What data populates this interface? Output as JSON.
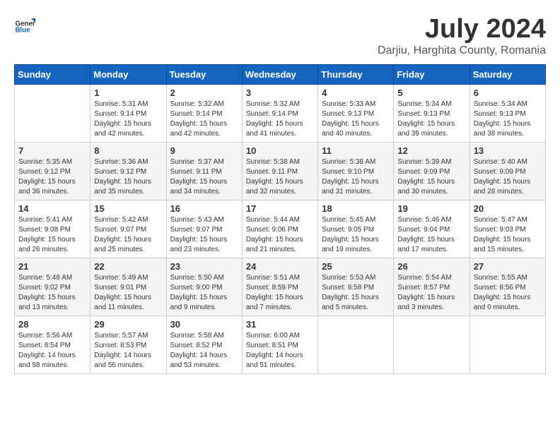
{
  "logo": {
    "general": "General",
    "blue": "Blue"
  },
  "title": "July 2024",
  "subtitle": "Darjiu, Harghita County, Romania",
  "weekdays": [
    "Sunday",
    "Monday",
    "Tuesday",
    "Wednesday",
    "Thursday",
    "Friday",
    "Saturday"
  ],
  "weeks": [
    [
      {
        "day": "",
        "sunrise": "",
        "sunset": "",
        "daylight": ""
      },
      {
        "day": "1",
        "sunrise": "Sunrise: 5:31 AM",
        "sunset": "Sunset: 9:14 PM",
        "daylight": "Daylight: 15 hours and 42 minutes."
      },
      {
        "day": "2",
        "sunrise": "Sunrise: 5:32 AM",
        "sunset": "Sunset: 9:14 PM",
        "daylight": "Daylight: 15 hours and 42 minutes."
      },
      {
        "day": "3",
        "sunrise": "Sunrise: 5:32 AM",
        "sunset": "Sunset: 9:14 PM",
        "daylight": "Daylight: 15 hours and 41 minutes."
      },
      {
        "day": "4",
        "sunrise": "Sunrise: 5:33 AM",
        "sunset": "Sunset: 9:13 PM",
        "daylight": "Daylight: 15 hours and 40 minutes."
      },
      {
        "day": "5",
        "sunrise": "Sunrise: 5:34 AM",
        "sunset": "Sunset: 9:13 PM",
        "daylight": "Daylight: 15 hours and 39 minutes."
      },
      {
        "day": "6",
        "sunrise": "Sunrise: 5:34 AM",
        "sunset": "Sunset: 9:13 PM",
        "daylight": "Daylight: 15 hours and 38 minutes."
      }
    ],
    [
      {
        "day": "7",
        "sunrise": "Sunrise: 5:35 AM",
        "sunset": "Sunset: 9:12 PM",
        "daylight": "Daylight: 15 hours and 36 minutes."
      },
      {
        "day": "8",
        "sunrise": "Sunrise: 5:36 AM",
        "sunset": "Sunset: 9:12 PM",
        "daylight": "Daylight: 15 hours and 35 minutes."
      },
      {
        "day": "9",
        "sunrise": "Sunrise: 5:37 AM",
        "sunset": "Sunset: 9:11 PM",
        "daylight": "Daylight: 15 hours and 34 minutes."
      },
      {
        "day": "10",
        "sunrise": "Sunrise: 5:38 AM",
        "sunset": "Sunset: 9:11 PM",
        "daylight": "Daylight: 15 hours and 32 minutes."
      },
      {
        "day": "11",
        "sunrise": "Sunrise: 5:38 AM",
        "sunset": "Sunset: 9:10 PM",
        "daylight": "Daylight: 15 hours and 31 minutes."
      },
      {
        "day": "12",
        "sunrise": "Sunrise: 5:39 AM",
        "sunset": "Sunset: 9:09 PM",
        "daylight": "Daylight: 15 hours and 30 minutes."
      },
      {
        "day": "13",
        "sunrise": "Sunrise: 5:40 AM",
        "sunset": "Sunset: 9:09 PM",
        "daylight": "Daylight: 15 hours and 28 minutes."
      }
    ],
    [
      {
        "day": "14",
        "sunrise": "Sunrise: 5:41 AM",
        "sunset": "Sunset: 9:08 PM",
        "daylight": "Daylight: 15 hours and 26 minutes."
      },
      {
        "day": "15",
        "sunrise": "Sunrise: 5:42 AM",
        "sunset": "Sunset: 9:07 PM",
        "daylight": "Daylight: 15 hours and 25 minutes."
      },
      {
        "day": "16",
        "sunrise": "Sunrise: 5:43 AM",
        "sunset": "Sunset: 9:07 PM",
        "daylight": "Daylight: 15 hours and 23 minutes."
      },
      {
        "day": "17",
        "sunrise": "Sunrise: 5:44 AM",
        "sunset": "Sunset: 9:06 PM",
        "daylight": "Daylight: 15 hours and 21 minutes."
      },
      {
        "day": "18",
        "sunrise": "Sunrise: 5:45 AM",
        "sunset": "Sunset: 9:05 PM",
        "daylight": "Daylight: 15 hours and 19 minutes."
      },
      {
        "day": "19",
        "sunrise": "Sunrise: 5:46 AM",
        "sunset": "Sunset: 9:04 PM",
        "daylight": "Daylight: 15 hours and 17 minutes."
      },
      {
        "day": "20",
        "sunrise": "Sunrise: 5:47 AM",
        "sunset": "Sunset: 9:03 PM",
        "daylight": "Daylight: 15 hours and 15 minutes."
      }
    ],
    [
      {
        "day": "21",
        "sunrise": "Sunrise: 5:48 AM",
        "sunset": "Sunset: 9:02 PM",
        "daylight": "Daylight: 15 hours and 13 minutes."
      },
      {
        "day": "22",
        "sunrise": "Sunrise: 5:49 AM",
        "sunset": "Sunset: 9:01 PM",
        "daylight": "Daylight: 15 hours and 11 minutes."
      },
      {
        "day": "23",
        "sunrise": "Sunrise: 5:50 AM",
        "sunset": "Sunset: 9:00 PM",
        "daylight": "Daylight: 15 hours and 9 minutes."
      },
      {
        "day": "24",
        "sunrise": "Sunrise: 5:51 AM",
        "sunset": "Sunset: 8:59 PM",
        "daylight": "Daylight: 15 hours and 7 minutes."
      },
      {
        "day": "25",
        "sunrise": "Sunrise: 5:53 AM",
        "sunset": "Sunset: 8:58 PM",
        "daylight": "Daylight: 15 hours and 5 minutes."
      },
      {
        "day": "26",
        "sunrise": "Sunrise: 5:54 AM",
        "sunset": "Sunset: 8:57 PM",
        "daylight": "Daylight: 15 hours and 3 minutes."
      },
      {
        "day": "27",
        "sunrise": "Sunrise: 5:55 AM",
        "sunset": "Sunset: 8:56 PM",
        "daylight": "Daylight: 15 hours and 0 minutes."
      }
    ],
    [
      {
        "day": "28",
        "sunrise": "Sunrise: 5:56 AM",
        "sunset": "Sunset: 8:54 PM",
        "daylight": "Daylight: 14 hours and 58 minutes."
      },
      {
        "day": "29",
        "sunrise": "Sunrise: 5:57 AM",
        "sunset": "Sunset: 8:53 PM",
        "daylight": "Daylight: 14 hours and 56 minutes."
      },
      {
        "day": "30",
        "sunrise": "Sunrise: 5:58 AM",
        "sunset": "Sunset: 8:52 PM",
        "daylight": "Daylight: 14 hours and 53 minutes."
      },
      {
        "day": "31",
        "sunrise": "Sunrise: 6:00 AM",
        "sunset": "Sunset: 8:51 PM",
        "daylight": "Daylight: 14 hours and 51 minutes."
      },
      {
        "day": "",
        "sunrise": "",
        "sunset": "",
        "daylight": ""
      },
      {
        "day": "",
        "sunrise": "",
        "sunset": "",
        "daylight": ""
      },
      {
        "day": "",
        "sunrise": "",
        "sunset": "",
        "daylight": ""
      }
    ]
  ]
}
